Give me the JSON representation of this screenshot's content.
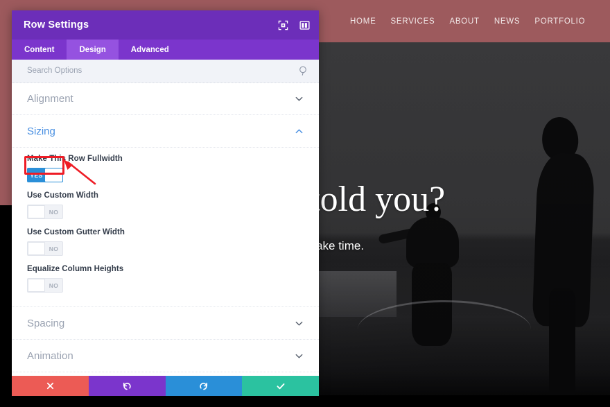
{
  "site": {
    "nav": [
      {
        "label": "HOME"
      },
      {
        "label": "SERVICES"
      },
      {
        "label": "ABOUT"
      },
      {
        "label": "NEWS"
      },
      {
        "label": "PORTFOLIO"
      }
    ],
    "hero": {
      "headline": "as no one told you?",
      "subheadline": "Good things take time."
    },
    "colors": {
      "topbar": "#9d5a5d",
      "hero_bg": "#3a3a3c"
    }
  },
  "modal": {
    "title": "Row Settings",
    "header_icons": [
      {
        "name": "fullscreen-icon"
      },
      {
        "name": "layout-split-icon"
      }
    ],
    "tabs": [
      {
        "label": "Content",
        "active": false
      },
      {
        "label": "Design",
        "active": true
      },
      {
        "label": "Advanced",
        "active": false
      }
    ],
    "search": {
      "placeholder": "Search Options",
      "value": ""
    },
    "sections": [
      {
        "title": "Alignment",
        "open": false
      },
      {
        "title": "Sizing",
        "open": true
      },
      {
        "title": "Spacing",
        "open": false
      },
      {
        "title": "Animation",
        "open": false
      }
    ],
    "sizing_fields": [
      {
        "label": "Make This Row Fullwidth",
        "value": "YES",
        "state": "on",
        "highlighted": true
      },
      {
        "label": "Use Custom Width",
        "value": "NO",
        "state": "off",
        "highlighted": false
      },
      {
        "label": "Use Custom Gutter Width",
        "value": "NO",
        "state": "off",
        "highlighted": false
      },
      {
        "label": "Equalize Column Heights",
        "value": "NO",
        "state": "off",
        "highlighted": false
      }
    ],
    "footer_buttons": [
      {
        "name": "cancel-button",
        "icon": "x-icon",
        "color": "#ec5b55"
      },
      {
        "name": "undo-button",
        "icon": "undo-icon",
        "color": "#7b35cc"
      },
      {
        "name": "redo-button",
        "icon": "redo-icon",
        "color": "#2a8fd8"
      },
      {
        "name": "save-button",
        "icon": "check-icon",
        "color": "#2bc2a0"
      }
    ],
    "colors": {
      "header": "#6c2eb9",
      "tabbar": "#7b35cc",
      "tab_active": "#9552e0",
      "accent_blue": "#4a90e2",
      "toggle_on": "#2a8fd8",
      "annotation_red": "#ee1c25"
    }
  }
}
